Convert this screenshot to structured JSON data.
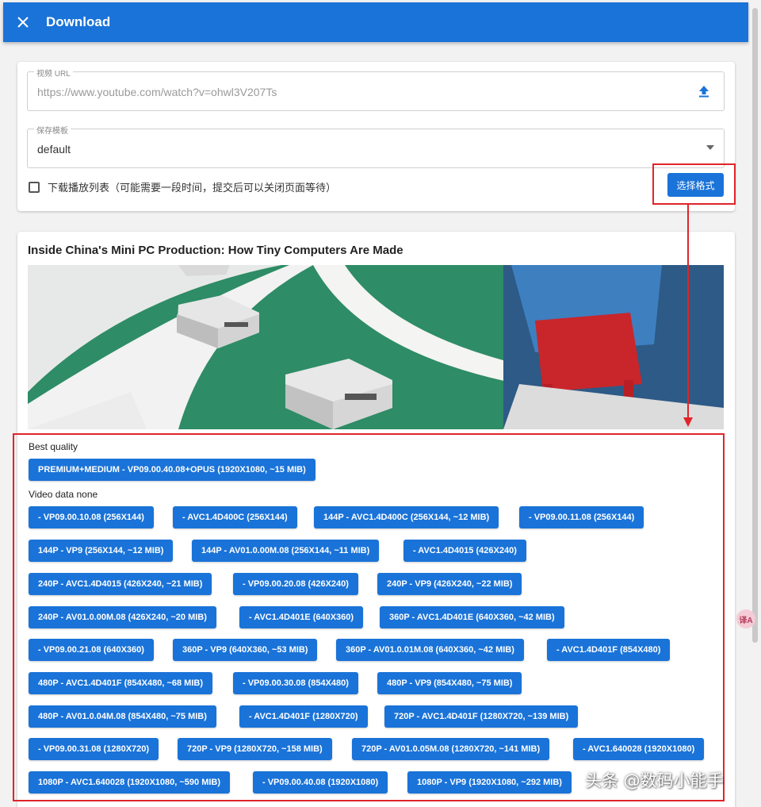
{
  "appbar": {
    "title": "Download",
    "close_icon": "close-icon"
  },
  "form": {
    "url": {
      "label": "视频 URL",
      "placeholder": "https://www.youtube.com/watch?v=ohwl3V207Ts",
      "icon": "upload-icon"
    },
    "template": {
      "label": "保存模板",
      "value": "default",
      "icon": "dropdown-icon"
    },
    "playlist_label": "下载播放列表（可能需要一段时间，提交后可以关闭页面等待）",
    "select_format_label": "选择格式"
  },
  "video": {
    "title": "Inside China's Mini PC Production: How Tiny Computers Are Made",
    "best_quality_label": "Best quality",
    "best_button": "PREMIUM+MEDIUM - VP09.00.40.08+OPUS (1920X1080, ~15 MIB)",
    "video_label": "Video data none",
    "formats": [
      "- VP09.00.10.08 (256X144)",
      "- AVC1.4D400C (256X144)",
      "144P - AVC1.4D400C (256X144, ~12 MIB)",
      "- VP09.00.11.08 (256X144)",
      "144P - VP9 (256X144, ~12 MIB)",
      "144P - AV01.0.00M.08 (256X144, ~11 MIB)",
      "- AVC1.4D4015 (426X240)",
      "240P - AVC1.4D4015 (426X240, ~21 MIB)",
      "- VP09.00.20.08 (426X240)",
      "240P - VP9 (426X240, ~22 MIB)",
      "240P - AV01.0.00M.08 (426X240, ~20 MIB)",
      "- AVC1.4D401E (640X360)",
      "360P - AVC1.4D401E (640X360, ~42 MIB)",
      "- VP09.00.21.08 (640X360)",
      "360P - VP9 (640X360, ~53 MIB)",
      "360P - AV01.0.01M.08 (640X360, ~42 MIB)",
      "- AVC1.4D401F (854X480)",
      "480P - AVC1.4D401F (854X480, ~68 MIB)",
      "- VP09.00.30.08 (854X480)",
      "480P - VP9 (854X480, ~75 MIB)",
      "480P - AV01.0.04M.08 (854X480, ~75 MIB)",
      "- AVC1.4D401F (1280X720)",
      "720P - AVC1.4D401F (1280X720, ~139 MIB)",
      "- VP09.00.31.08 (1280X720)",
      "720P - VP9 (1280X720, ~158 MIB)",
      "720P - AV01.0.05M.08 (1280X720, ~141 MIB)",
      "- AVC1.640028 (1920X1080)",
      "1080P - AVC1.640028 (1920X1080, ~590 MIB)",
      "- VP09.00.40.08 (1920X1080)",
      "1080P - VP9 (1920X1080, ~292 MIB)"
    ]
  },
  "watermark": "头条 @数码小能手",
  "badge": "译A",
  "colors": {
    "primary": "#1a73d8",
    "annotation": "#e0242a"
  }
}
